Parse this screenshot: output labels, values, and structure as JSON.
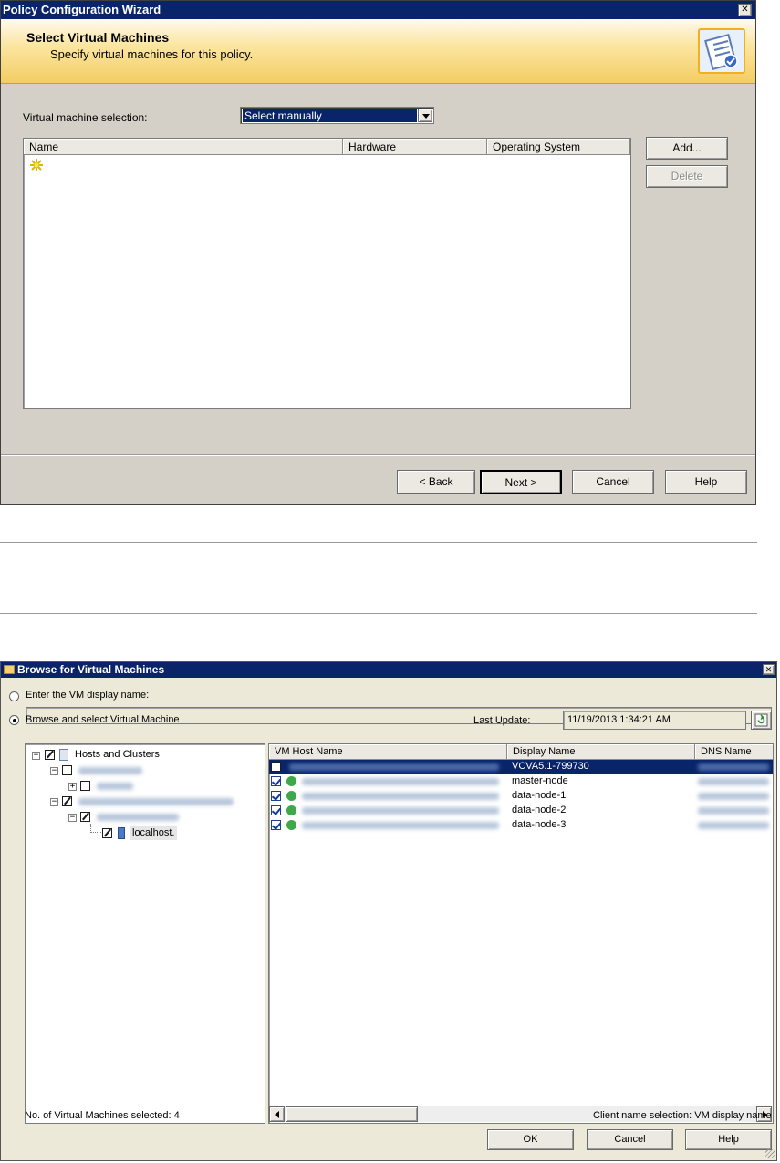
{
  "wizard": {
    "title": "Policy Configuration Wizard",
    "header_title": "Select Virtual Machines",
    "header_subtitle": "Specify virtual machines for this policy.",
    "selection_label": "Virtual machine selection:",
    "selection_value": "Select manually",
    "columns": [
      "Name",
      "Hardware",
      "Operating System"
    ],
    "add_label": "Add...",
    "delete_label": "Delete",
    "back_label": "< Back",
    "next_label": "Next >",
    "cancel_label": "Cancel",
    "help_label": "Help",
    "close_glyph": "✕"
  },
  "browse": {
    "title": "Browse for Virtual Machines",
    "radio_enter_label": "Enter the VM display name:",
    "radio_browse_label": "Browse and select Virtual Machine",
    "last_update_label": "Last Update:",
    "last_update_value": "11/19/2013 1:34:21 AM",
    "tree": {
      "root_label": "Hosts and Clusters",
      "leaf_label": "localhost."
    },
    "columns": [
      "VM Host Name",
      "Display Name",
      "DNS Name"
    ],
    "rows": [
      {
        "display_name": "VCVA5.1-799730",
        "checked": false,
        "selected": true
      },
      {
        "display_name": "master-node",
        "checked": true,
        "selected": false
      },
      {
        "display_name": "data-node-1",
        "checked": true,
        "selected": false
      },
      {
        "display_name": "data-node-2",
        "checked": true,
        "selected": false
      },
      {
        "display_name": "data-node-3",
        "checked": true,
        "selected": false
      }
    ],
    "status_selected": "No. of Virtual Machines selected: 4",
    "status_client": "Client name selection: VM display name",
    "ok_label": "OK",
    "cancel_label": "Cancel",
    "help_label": "Help",
    "close_glyph": "✕"
  },
  "colors": {
    "titlebar": "#0a246a",
    "selection": "#0a246a",
    "header_band": "#fbe7a6",
    "dialog_bg": "#d4d0c8"
  }
}
